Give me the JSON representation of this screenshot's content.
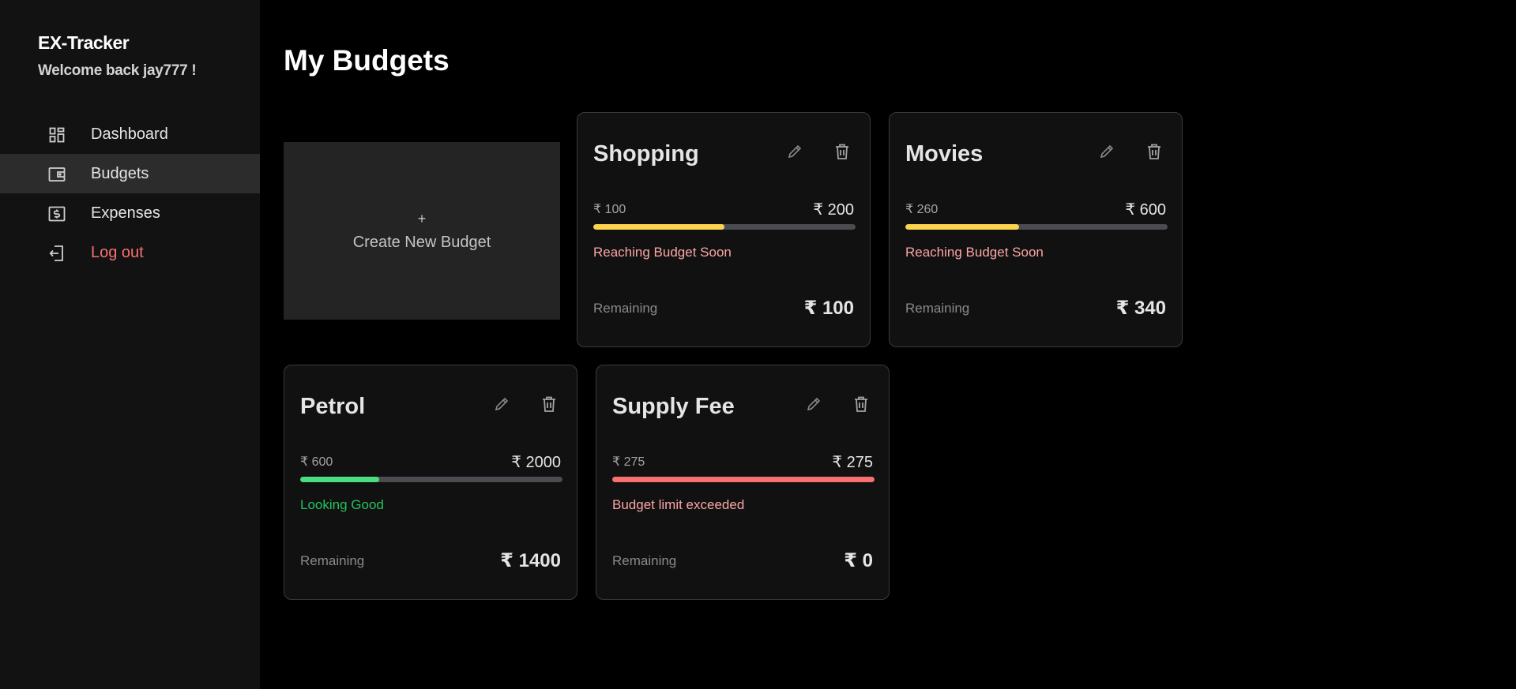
{
  "sidebar": {
    "brand": "EX-Tracker",
    "welcome": "Welcome back jay777 !",
    "items": [
      {
        "label": "Dashboard",
        "icon": "dashboard-icon",
        "active": false
      },
      {
        "label": "Budgets",
        "icon": "wallet-icon",
        "active": true
      },
      {
        "label": "Expenses",
        "icon": "dollar-receipt-icon",
        "active": false
      },
      {
        "label": "Log out",
        "icon": "logout-icon",
        "active": false
      }
    ]
  },
  "main": {
    "title": "My Budgets",
    "create_card": {
      "plus": "+",
      "label": "Create New Budget"
    }
  },
  "budgets": [
    {
      "name": "Shopping",
      "spent": "₹ 100",
      "total": "₹ 200",
      "progress": 0.5,
      "bar_color": "#fcd34d",
      "status": "Reaching Budget Soon",
      "status_color": "#fca5a5",
      "remaining_label": "Remaining",
      "remaining": "₹ 100"
    },
    {
      "name": "Movies",
      "spent": "₹ 260",
      "total": "₹ 600",
      "progress": 0.433,
      "bar_color": "#fcd34d",
      "status": "Reaching Budget Soon",
      "status_color": "#fca5a5",
      "remaining_label": "Remaining",
      "remaining": "₹ 340"
    },
    {
      "name": "Petrol",
      "spent": "₹ 600",
      "total": "₹ 2000",
      "progress": 0.3,
      "bar_color": "#4ade80",
      "status": "Looking Good",
      "status_color": "#22c55e",
      "remaining_label": "Remaining",
      "remaining": "₹ 1400"
    },
    {
      "name": "Supply Fee",
      "spent": "₹ 275",
      "total": "₹ 275",
      "progress": 1.0,
      "bar_color": "#f87171",
      "status": "Budget limit exceeded",
      "status_color": "#fca5a5",
      "remaining_label": "Remaining",
      "remaining": "₹ 0"
    }
  ],
  "colors": {
    "sidebar_bg": "#121212",
    "active_item_bg": "#2c2c2c",
    "logout": "#f87171",
    "card_bg": "#111111"
  }
}
